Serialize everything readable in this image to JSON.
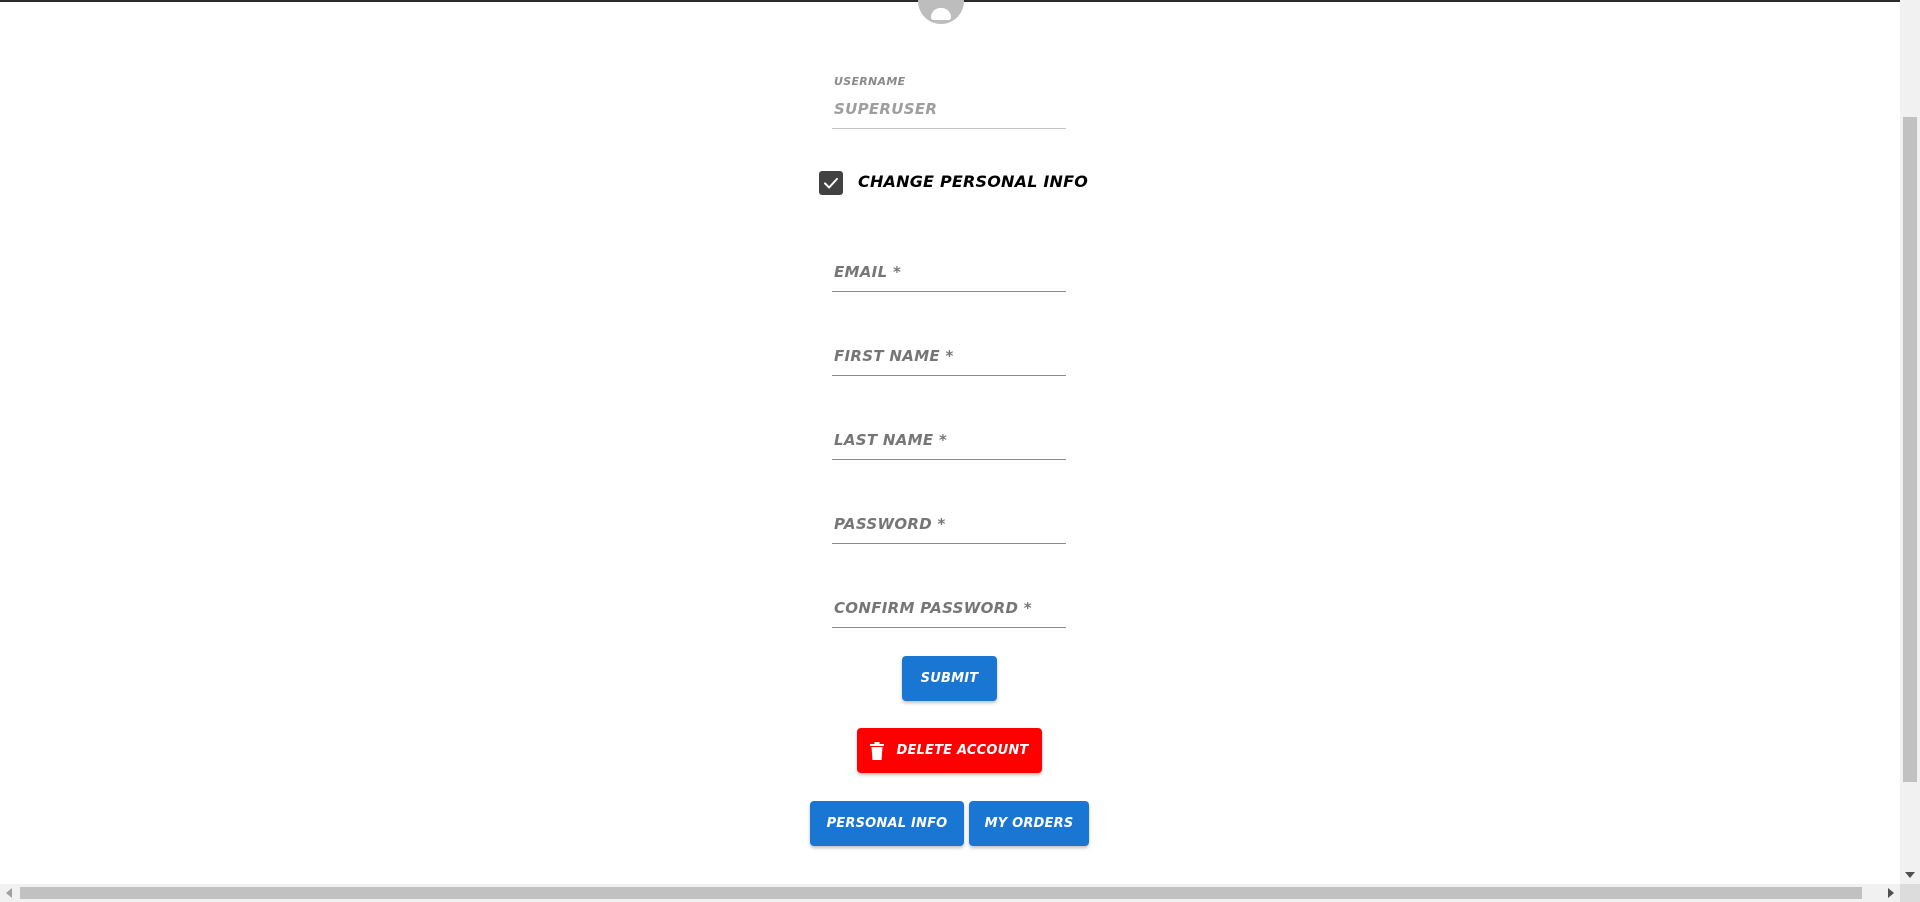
{
  "form": {
    "username": {
      "label": "USERNAME",
      "value": "SUPERUSER"
    },
    "change_info": {
      "label": "CHANGE PERSONAL INFO",
      "checked": true
    },
    "email": {
      "label": "EMAIL *"
    },
    "first_name": {
      "label": "FIRST NAME *"
    },
    "last_name": {
      "label": "LAST NAME *"
    },
    "password": {
      "label": "PASSWORD *"
    },
    "confirm_password": {
      "label": "CONFIRM PASSWORD *"
    },
    "submit_label": "SUBMIT",
    "delete_label": "DELETE ACCOUNT"
  },
  "nav": {
    "personal_info_label": "PERSONAL INFO",
    "my_orders_label": "MY ORDERS"
  },
  "icons": {
    "avatar": "user-avatar-icon",
    "check": "checkmark-icon",
    "delete": "trash-icon"
  },
  "colors": {
    "primary": "#1976d2",
    "danger": "#ff0000",
    "checkbox": "#424242"
  }
}
